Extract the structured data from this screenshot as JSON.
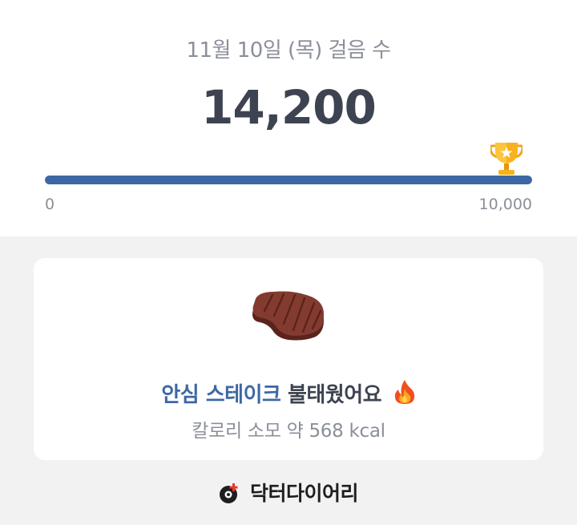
{
  "header": {
    "date_title": "11월 10일 (목) 걸음 수",
    "steps": "14,200"
  },
  "progress": {
    "min_label": "0",
    "max_label": "10,000",
    "fraction": 1.0,
    "goal_icon": "trophy-icon"
  },
  "card": {
    "food_icon": "steak-icon",
    "food_name": "안심 스테이크",
    "burn_text": "불태웠어요",
    "fire_icon": "fire-icon",
    "calorie_text": "칼로리 소모 약 568 kcal"
  },
  "brand": {
    "name": "닥터다이어리",
    "logo_icon": "doctor-diary-logo-icon"
  },
  "colors": {
    "accent": "#3d67a4",
    "text_dark": "#3d4350",
    "text_muted": "#8a8f99",
    "background": "#f2f2f2"
  }
}
